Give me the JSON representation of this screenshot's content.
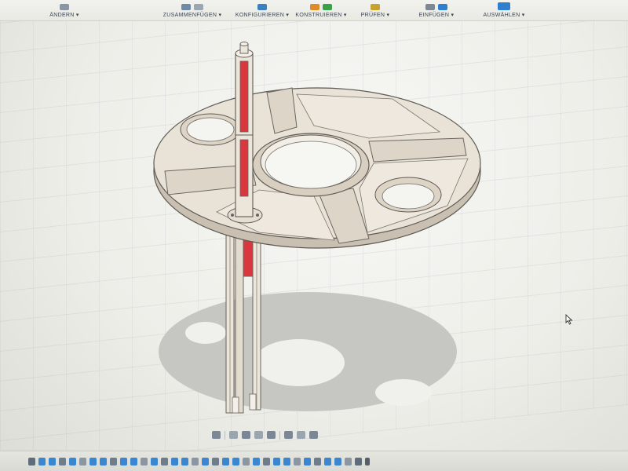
{
  "toolbar": {
    "groups": [
      {
        "id": "modify",
        "label": "ÄNDERN",
        "icon": "modify-icon"
      },
      {
        "id": "assemble",
        "label": "ZUSAMMENFÜGEN",
        "icon": "assemble-icon"
      },
      {
        "id": "configure",
        "label": "KONFIGURIEREN",
        "icon": "configure-icon"
      },
      {
        "id": "construct",
        "label": "KONSTRUIEREN",
        "icon": "construct-icon"
      },
      {
        "id": "inspect",
        "label": "PRÜFEN",
        "icon": "inspect-icon"
      },
      {
        "id": "insert",
        "label": "EINFÜGEN",
        "icon": "insert-icon"
      },
      {
        "id": "select",
        "label": "AUSWÄHLEN",
        "icon": "select-icon"
      }
    ]
  },
  "navbar": {
    "buttons": [
      "orbit-icon",
      "look-at-icon",
      "pan-icon",
      "zoom-icon",
      "fit-icon",
      "display-settings-icon",
      "grid-snap-icon",
      "viewports-icon"
    ]
  },
  "model": {
    "description_colors": {
      "body": "#e8e1d6",
      "edge": "#6a6660",
      "highlight": "#d9363e",
      "shadow": "#c9c9c6"
    }
  },
  "timeline": {
    "item_count": 34
  }
}
